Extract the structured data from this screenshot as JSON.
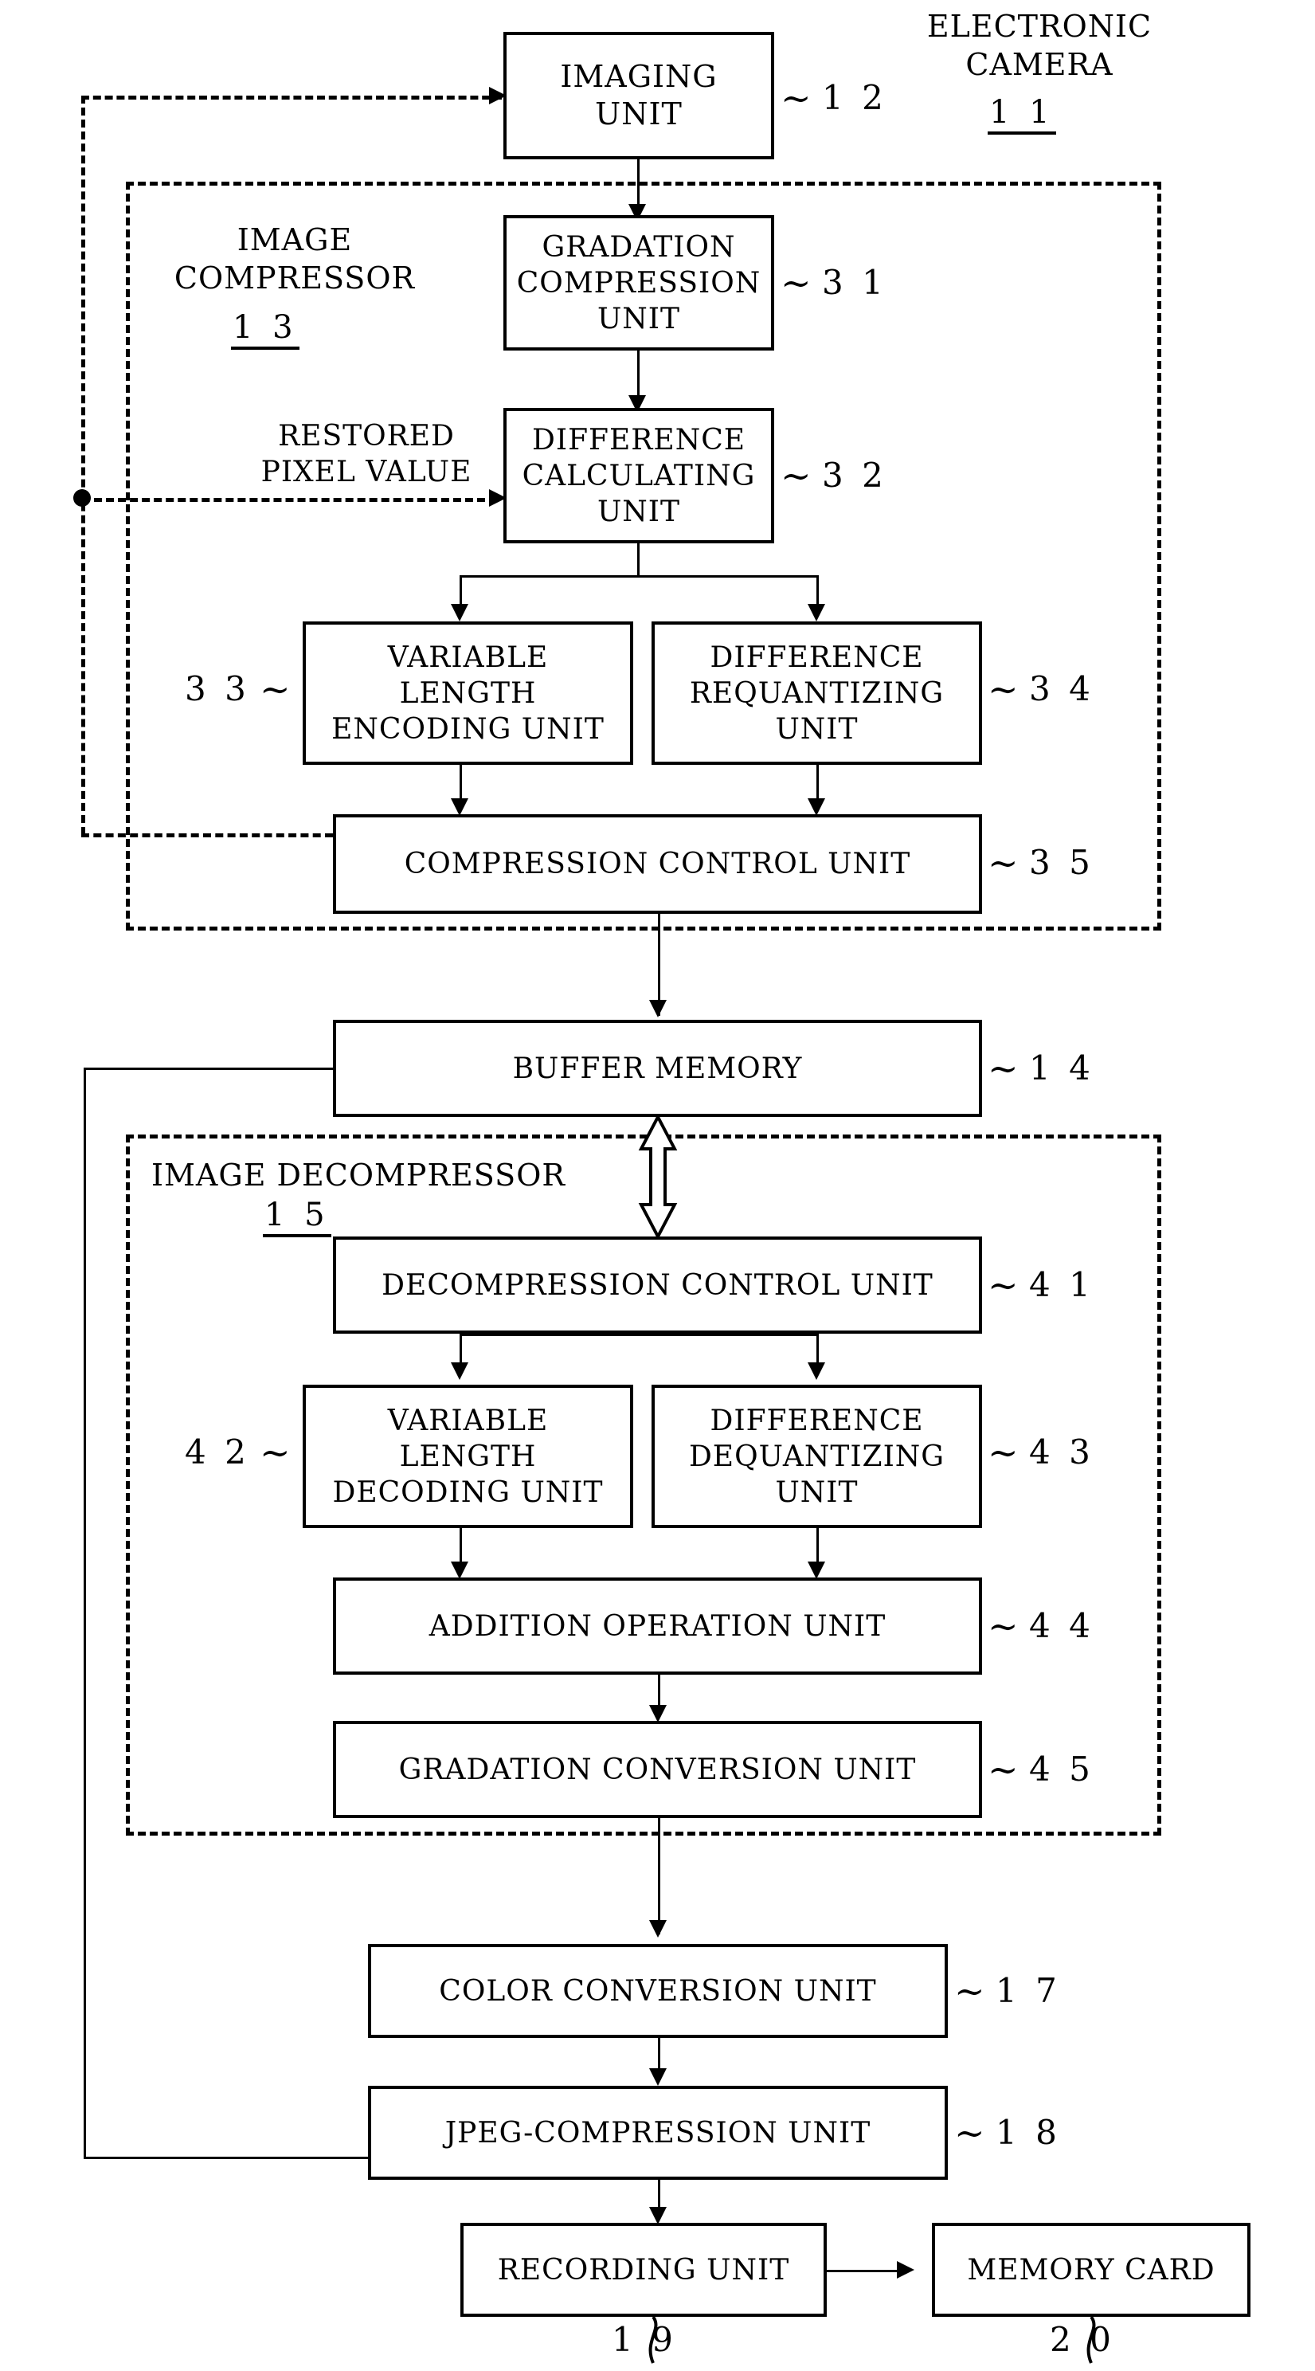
{
  "figure": {
    "system_label": "ELECTRONIC\nCAMERA",
    "system_ref": "1 1",
    "compressor_label": "IMAGE\nCOMPRESSOR",
    "compressor_ref": "1 3",
    "decompressor_label": "IMAGE DECOMPRESSOR",
    "decompressor_ref": "1 5",
    "restored_pixel_label": "RESTORED\nPIXEL VALUE"
  },
  "blocks": {
    "imaging_unit": {
      "label": "IMAGING\nUNIT",
      "ref": "1 2"
    },
    "gradation_compression_unit": {
      "label": "GRADATION\nCOMPRESSION\nUNIT",
      "ref": "3 1"
    },
    "difference_calculating_unit": {
      "label": "DIFFERENCE\nCALCULATING\nUNIT",
      "ref": "3 2"
    },
    "variable_length_encoding_unit": {
      "label": "VARIABLE\nLENGTH\nENCODING UNIT",
      "ref": "3 3"
    },
    "difference_requantizing_unit": {
      "label": "DIFFERENCE\nREQUANTIZING\nUNIT",
      "ref": "3 4"
    },
    "compression_control_unit": {
      "label": "COMPRESSION CONTROL UNIT",
      "ref": "3 5"
    },
    "buffer_memory": {
      "label": "BUFFER MEMORY",
      "ref": "1 4"
    },
    "decompression_control_unit": {
      "label": "DECOMPRESSION CONTROL UNIT",
      "ref": "4 1"
    },
    "variable_length_decoding_unit": {
      "label": "VARIABLE\nLENGTH\nDECODING UNIT",
      "ref": "4 2"
    },
    "difference_dequantizing_unit": {
      "label": "DIFFERENCE\nDEQUANTIZING\nUNIT",
      "ref": "4 3"
    },
    "addition_operation_unit": {
      "label": "ADDITION OPERATION UNIT",
      "ref": "4 4"
    },
    "gradation_conversion_unit": {
      "label": "GRADATION CONVERSION UNIT",
      "ref": "4 5"
    },
    "color_conversion_unit": {
      "label": "COLOR CONVERSION UNIT",
      "ref": "1 7"
    },
    "jpeg_compression_unit": {
      "label": "JPEG-COMPRESSION UNIT",
      "ref": "1 8"
    },
    "recording_unit": {
      "label": "RECORDING UNIT",
      "ref": "1 9"
    },
    "memory_card": {
      "label": "MEMORY CARD",
      "ref": "2 0"
    }
  },
  "icons": {
    "squiggle": "∼",
    "junction_dot": "●"
  }
}
